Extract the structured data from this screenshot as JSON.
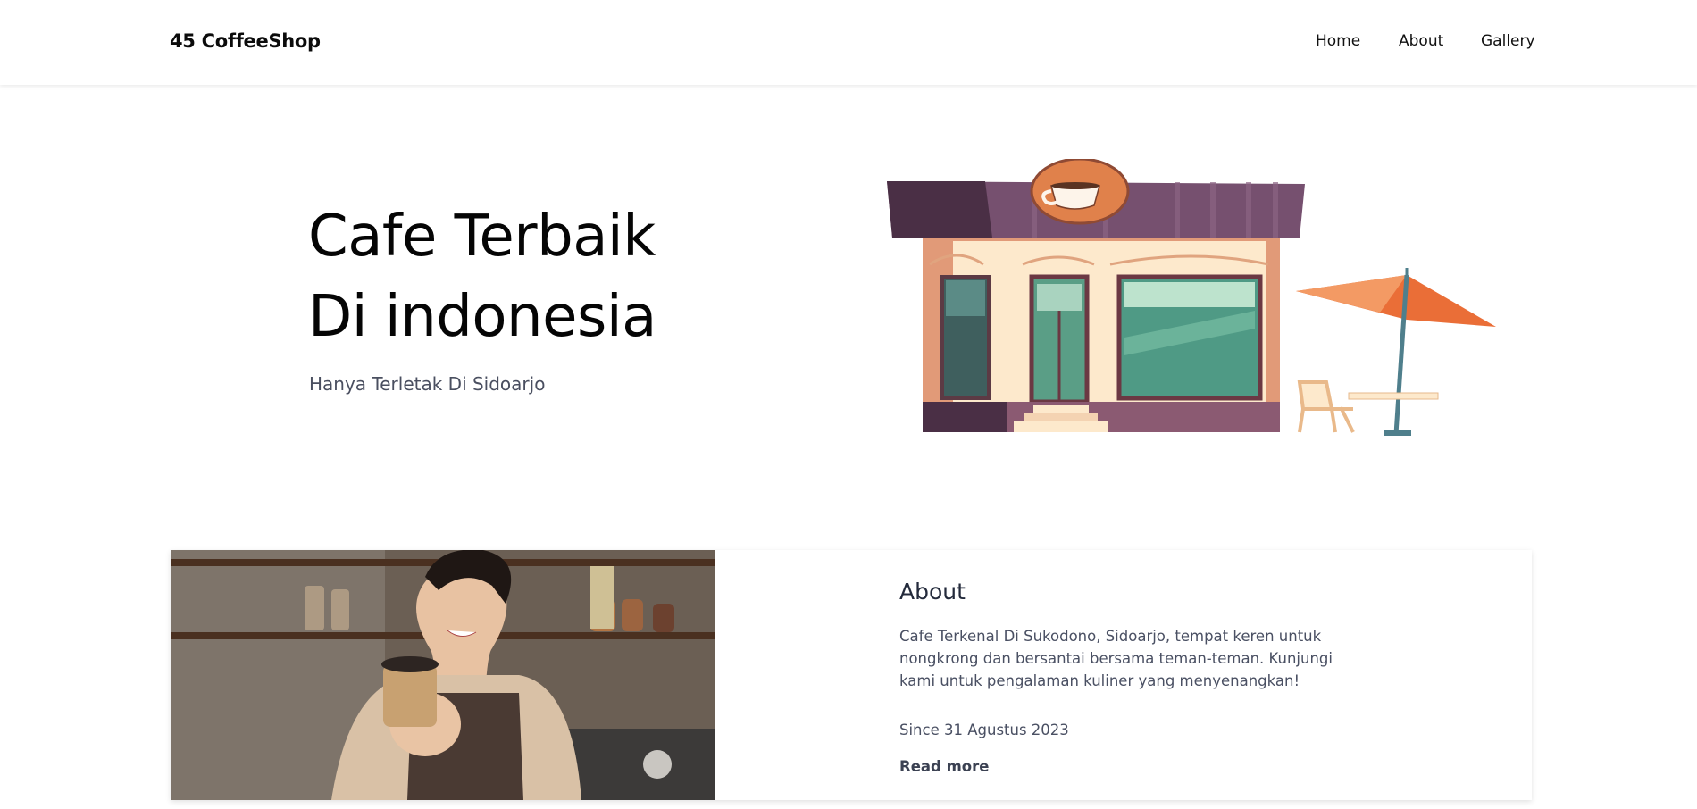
{
  "navbar": {
    "brand": "45 CoffeeShop",
    "links": [
      {
        "label": "Home"
      },
      {
        "label": "About"
      },
      {
        "label": "Gallery"
      }
    ]
  },
  "hero": {
    "title_line1": "Cafe Terbaik",
    "title_line2": "Di indonesia",
    "subtitle": "Hanya Terletak Di Sidoarjo"
  },
  "about": {
    "title": "About",
    "description": "Cafe Terkenal Di Sukodono, Sidoarjo, tempat keren untuk nongkrong dan bersantai bersama teman-teman. Kunjungi kami untuk pengalaman kuliner yang menyenangkan!",
    "since": "Since 31 Agustus 2023",
    "read_more": "Read more"
  },
  "colors": {
    "roof_dark": "#4a2f45",
    "roof": "#76506f",
    "sign_orange": "#e0814b",
    "wall_peach": "#e19a78",
    "wall_cream": "#fde9cc",
    "window_green": "#4f9a85",
    "umbrella_orange": "#ea6e37",
    "pole_teal": "#4f7f8c"
  },
  "icons": [
    "coffee-cup-icon"
  ]
}
